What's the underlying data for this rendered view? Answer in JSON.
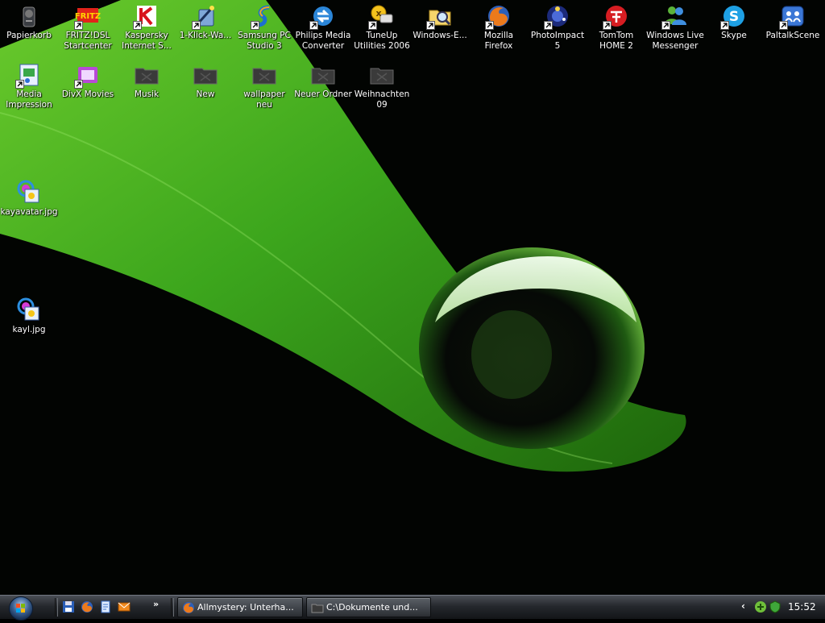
{
  "desktop": {
    "icons": [
      {
        "id": "papierkorb",
        "label": "Papierkorb",
        "icon": "recycle-bin-icon",
        "shortcut": false
      },
      {
        "id": "fritzdsl",
        "label": "FRITZ!DSL Startcenter",
        "icon": "fritz-icon",
        "shortcut": true
      },
      {
        "id": "kaspersky",
        "label": "Kaspersky Internet S...",
        "icon": "kaspersky-icon",
        "shortcut": true
      },
      {
        "id": "1klick",
        "label": "1-Klick-Wa...",
        "icon": "wand-icon",
        "shortcut": true
      },
      {
        "id": "samsung",
        "label": "Samsung PC Studio 3",
        "icon": "samsung-icon",
        "shortcut": true
      },
      {
        "id": "philips",
        "label": "Philips Media Converter",
        "icon": "philips-icon",
        "shortcut": true
      },
      {
        "id": "tuneup",
        "label": "TuneUp Utilities 2006",
        "icon": "tuneup-icon",
        "shortcut": true
      },
      {
        "id": "windowse",
        "label": "Windows-E...",
        "icon": "explorer-icon",
        "shortcut": true
      },
      {
        "id": "firefox",
        "label": "Mozilla Firefox",
        "icon": "firefox-icon",
        "shortcut": true
      },
      {
        "id": "photoimpact",
        "label": "PhotoImpact 5",
        "icon": "photoimpact-icon",
        "shortcut": true
      },
      {
        "id": "tomtom",
        "label": "TomTom HOME 2",
        "icon": "tomtom-icon",
        "shortcut": true
      },
      {
        "id": "wlm",
        "label": "Windows Live Messenger",
        "icon": "messenger-icon",
        "shortcut": true
      },
      {
        "id": "skype",
        "label": "Skype",
        "icon": "skype-icon",
        "shortcut": true
      },
      {
        "id": "paltalk",
        "label": "PaltalkScene",
        "icon": "paltalk-icon",
        "shortcut": true
      },
      {
        "id": "mediaimpression",
        "label": "Media Impression",
        "icon": "media-impression-icon",
        "shortcut": true
      },
      {
        "id": "divx",
        "label": "DivX Movies",
        "icon": "divx-icon",
        "shortcut": true
      },
      {
        "id": "musik",
        "label": "Musik",
        "icon": "folder-icon",
        "shortcut": false
      },
      {
        "id": "new",
        "label": "New",
        "icon": "folder-icon",
        "shortcut": false
      },
      {
        "id": "wallpaper",
        "label": "wallpaper neu",
        "icon": "folder-icon",
        "shortcut": false
      },
      {
        "id": "neuerordner",
        "label": "Neuer Ordner",
        "icon": "folder-icon",
        "shortcut": false
      },
      {
        "id": "weihnachten",
        "label": "Weihnachten 09",
        "icon": "folder-icon",
        "shortcut": false
      },
      {
        "id": "kayavatar",
        "label": "kayavatar.jpg",
        "icon": "image-file-icon",
        "shortcut": false
      },
      {
        "id": "kayl",
        "label": "kayl.jpg",
        "icon": "image-file-icon",
        "shortcut": false
      }
    ]
  },
  "taskbar": {
    "quick_launch": [
      {
        "icon": "save-icon"
      },
      {
        "icon": "firefox-icon"
      },
      {
        "icon": "document-icon"
      },
      {
        "icon": "mail-icon"
      }
    ],
    "more_glyph": "»",
    "tasks": [
      {
        "label": "Allmystery: Unterha...",
        "icon": "firefox-icon"
      },
      {
        "label": "C:\\Dokumente und...",
        "icon": "folder-icon"
      }
    ],
    "tray_arrow": "‹",
    "clock": "15:52"
  },
  "colors": {
    "leaf_green": "#3fae1e",
    "taskbar_dark": "#1a1c20"
  }
}
